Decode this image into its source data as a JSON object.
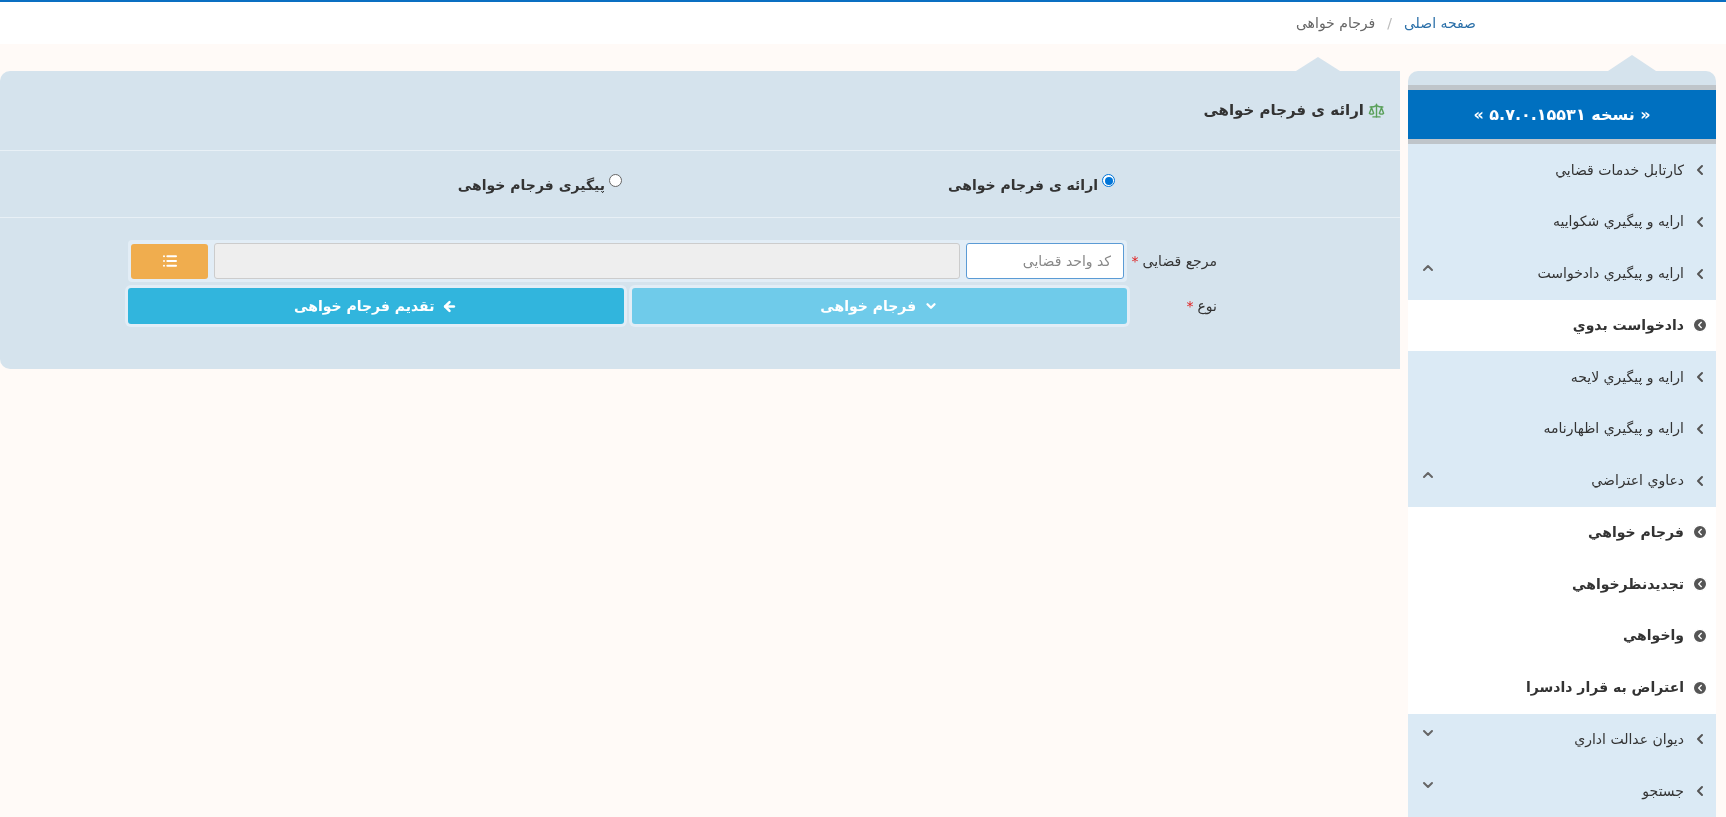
{
  "breadcrumb": [
    {
      "label": "صفحه اصلی",
      "kind": "link"
    },
    {
      "label": "/",
      "kind": "separator"
    },
    {
      "label": "فرجام خواهی",
      "kind": "current"
    }
  ],
  "sidebar": {
    "version": "« نسخه ۵.۷.۰.۱۵۵۳۱ »",
    "items": [
      {
        "label": "كارتابل خدمات قضايي"
      },
      {
        "label": "ارايه و پيگيري شكواييه"
      },
      {
        "label": "ارايه و پيگيري دادخواست",
        "expanded": true,
        "children": [
          {
            "label": "دادخواست بدوي"
          }
        ]
      },
      {
        "label": "ارايه و پيگيري لايحه"
      },
      {
        "label": "ارايه و پيگيري اظهارنامه"
      },
      {
        "label": "دعاوي اعتراضي",
        "expanded": true,
        "children": [
          {
            "label": "فرجام خواهي"
          },
          {
            "label": "تجديدنظرخواهي"
          },
          {
            "label": "واخواهي"
          },
          {
            "label": "اعتراض به قرار دادسرا"
          }
        ]
      },
      {
        "label": "ديوان عدالت اداري",
        "expanded": false
      },
      {
        "label": "جستجو",
        "expanded": false
      }
    ]
  },
  "panel": {
    "title": "ارائه ی فرجام خواهی",
    "options": [
      {
        "label": "ارائه ی فرجام خواهی",
        "selected": true
      },
      {
        "label": "پیگیری فرجام خواهی",
        "selected": false
      }
    ],
    "court_field": {
      "label": "مرجع قضایی",
      "required": "*",
      "placeholder": "کد واحد قضایی"
    },
    "type_field": {
      "label": "نوع",
      "required": "*",
      "value": "فرجام خواهی"
    },
    "submit": "تقدیم فرجام خواهی"
  }
}
